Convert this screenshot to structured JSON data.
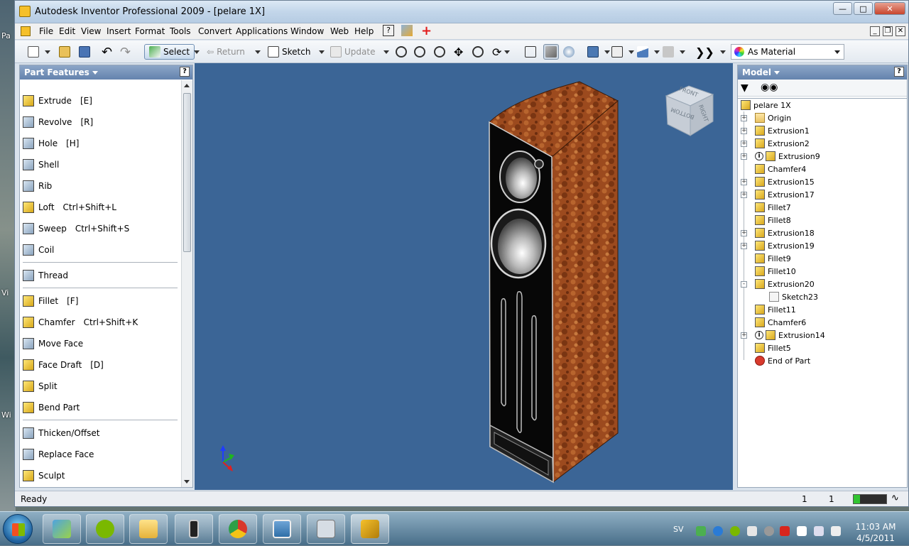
{
  "desktop": {
    "left_labels": [
      "Pa",
      "Vi",
      "Wi"
    ]
  },
  "window": {
    "title": "Autodesk Inventor Professional 2009 - [pelare 1X]"
  },
  "menu": [
    "File",
    "Edit",
    "View",
    "Insert",
    "Format",
    "Tools",
    "Convert",
    "Applications",
    "Window",
    "Web",
    "Help"
  ],
  "toolbar": {
    "select_label": "Select",
    "return_label": "Return",
    "sketch_label": "Sketch",
    "update_label": "Update",
    "appearance_value": "As Material"
  },
  "part_features": {
    "header": "Part Features",
    "items": [
      {
        "label": "Extrude",
        "shortcut": "[E]"
      },
      {
        "label": "Revolve",
        "shortcut": "[R]"
      },
      {
        "label": "Hole",
        "shortcut": "[H]"
      },
      {
        "label": "Shell",
        "shortcut": ""
      },
      {
        "label": "Rib",
        "shortcut": ""
      },
      {
        "label": "Loft",
        "shortcut": "Ctrl+Shift+L"
      },
      {
        "label": "Sweep",
        "shortcut": "Ctrl+Shift+S"
      },
      {
        "label": "Coil",
        "shortcut": ""
      },
      {
        "label": "Thread",
        "shortcut": ""
      },
      {
        "label": "Fillet",
        "shortcut": "[F]"
      },
      {
        "label": "Chamfer",
        "shortcut": "Ctrl+Shift+K"
      },
      {
        "label": "Move Face",
        "shortcut": ""
      },
      {
        "label": "Face Draft",
        "shortcut": "[D]"
      },
      {
        "label": "Split",
        "shortcut": ""
      },
      {
        "label": "Bend Part",
        "shortcut": ""
      },
      {
        "label": "Thicken/Offset",
        "shortcut": ""
      },
      {
        "label": "Replace Face",
        "shortcut": ""
      },
      {
        "label": "Sculpt",
        "shortcut": ""
      }
    ]
  },
  "viewcube": {
    "front": "FRONT",
    "right": "RIGHT",
    "bottom": "BOTTOM"
  },
  "model": {
    "header": "Model",
    "root": "pelare 1X",
    "nodes": [
      "Origin",
      "Extrusion1",
      "Extrusion2",
      "Extrusion9",
      "Chamfer4",
      "Extrusion15",
      "Extrusion17",
      "Fillet7",
      "Fillet8",
      "Extrusion18",
      "Extrusion19",
      "Fillet9",
      "Fillet10",
      "Extrusion20",
      "Sketch23",
      "Fillet11",
      "Chamfer6",
      "Extrusion14",
      "Fillet5",
      "End of Part"
    ]
  },
  "status": {
    "text": "Ready",
    "val1": "1",
    "val2": "1"
  },
  "taskbar": {
    "lang": "SV",
    "time": "11:03 AM",
    "date": "4/5/2011"
  },
  "colors": {
    "viewport_bg": "#3b6596",
    "panel_header": "#6f8db6",
    "feature_icon": "#f2c63a"
  }
}
